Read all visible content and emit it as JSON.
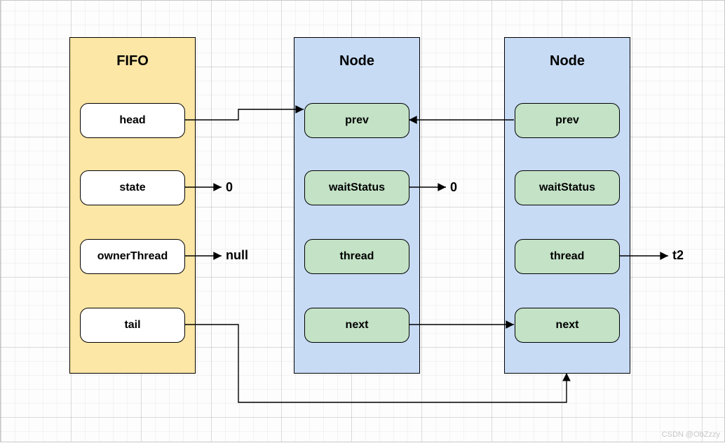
{
  "fifo": {
    "title": "FIFO",
    "fields": {
      "head": "head",
      "state": "state",
      "ownerThread": "ownerThread",
      "tail": "tail"
    },
    "values": {
      "state": "0",
      "ownerThread": "null"
    }
  },
  "node1": {
    "title": "Node",
    "fields": {
      "prev": "prev",
      "waitStatus": "waitStatus",
      "thread": "thread",
      "next": "next"
    },
    "values": {
      "waitStatus": "0"
    }
  },
  "node2": {
    "title": "Node",
    "fields": {
      "prev": "prev",
      "waitStatus": "waitStatus",
      "thread": "thread",
      "next": "next"
    },
    "values": {
      "thread": "t2"
    }
  },
  "watermark": "CSDN @ObZzzy"
}
